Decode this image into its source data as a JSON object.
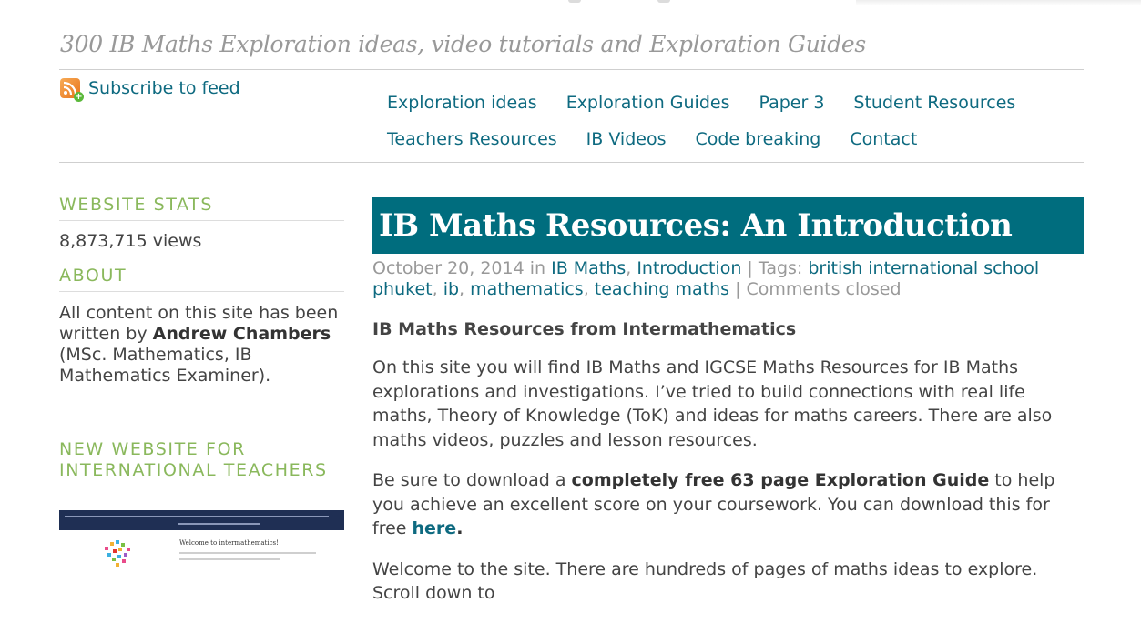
{
  "site": {
    "tagline": "300 IB Maths Exploration ideas, video tutorials and Exploration Guides",
    "subscribe_label": "Subscribe to feed"
  },
  "nav": {
    "row1": [
      "Exploration ideas",
      "Exploration Guides",
      "Paper 3",
      "Student Resources"
    ],
    "row2": [
      "Teachers Resources",
      "IB Videos",
      "Code breaking",
      "Contact"
    ]
  },
  "sidebar": {
    "stats_title": "WEBSITE STATS",
    "views": "8,873,715 views",
    "about_title": "ABOUT",
    "about_pre": "All content on this site has been written by",
    "about_author": "Andrew Chambers",
    "about_post": "(MSc. Mathematics, IB Mathematics Examiner).",
    "new_site_title": "NEW WEBSITE FOR INTERNATIONAL TEACHERS",
    "thumb_welcome": "Welcome to intermathematics!"
  },
  "post": {
    "title": "IB Maths Resources: An Introduction",
    "date": "October 20, 2014",
    "in_word": "in",
    "categories": [
      "IB Maths",
      "Introduction"
    ],
    "tags_label": "| Tags:",
    "tags": [
      "british international school phuket",
      "ib",
      "mathematics",
      "teaching maths"
    ],
    "comments": "Comments closed",
    "lead": "IB Maths Resources from Intermathematics",
    "p1": "On this site you will find IB Maths and IGCSE Maths Resources for IB Maths explorations and investigations. I’ve tried to build connections with real life maths, Theory of Knowledge (ToK) and ideas for maths careers. There are also maths videos, puzzles and lesson resources.",
    "p2_pre": "Be sure to download a",
    "p2_bold": "completely free 63 page Exploration Guide",
    "p2_mid": "to help you achieve an excellent score on your coursework.  You can download this for free",
    "p2_link": "here",
    "p2_end": ".",
    "p3": "Welcome to the site.  There are hundreds of pages of maths ideas to explore.  Scroll down to"
  },
  "colors": {
    "accent": "#006d7e",
    "link": "#0e6a80",
    "widget_title": "#8ab85c",
    "tagline": "#999999"
  }
}
